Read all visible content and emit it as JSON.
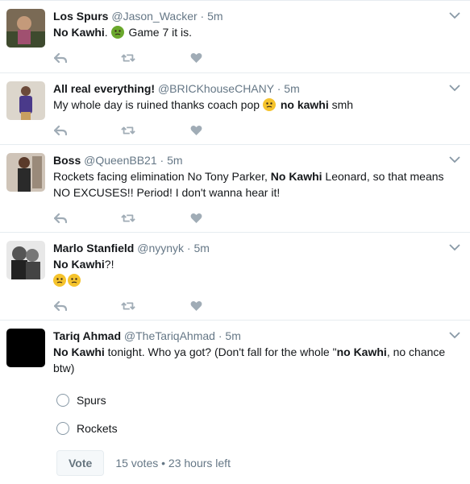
{
  "tweets": [
    {
      "name": "Los Spurs",
      "handle": "@Jason_Wacker",
      "time": "5m",
      "parts": [
        {
          "t": "No Kawhi",
          "b": true
        },
        {
          "t": ". "
        },
        {
          "emoji": "nauseated-face-emoji",
          "color": "#6aa82c"
        },
        {
          "t": " Game 7 it is."
        }
      ]
    },
    {
      "name": "All real everything!",
      "handle": "@BRICKhouseCHANY",
      "time": "5m",
      "parts": [
        {
          "t": "My whole day is ruined thanks coach pop "
        },
        {
          "emoji": "sad-face-emoji",
          "color": "#f5c32c"
        },
        {
          "t": " "
        },
        {
          "t": "no kawhi",
          "b": true
        },
        {
          "t": " smh"
        }
      ]
    },
    {
      "name": "Boss",
      "handle": "@QueenBB21",
      "time": "5m",
      "parts": [
        {
          "t": "Rockets facing elimination No Tony Parker, "
        },
        {
          "t": "No Kawhi",
          "b": true
        },
        {
          "t": " Leonard, so that means NO EXCUSES!! Period! I don't wanna hear it!"
        }
      ]
    },
    {
      "name": "Marlo Stanfield",
      "handle": "@nyynyk",
      "time": "5m",
      "parts": [
        {
          "t": "No Kawhi",
          "b": true
        },
        {
          "t": "?!"
        },
        {
          "br": true
        },
        {
          "emoji": "relieved-face-emoji",
          "color": "#f5c32c"
        },
        {
          "emoji": "relieved-face-emoji",
          "color": "#f5c32c"
        }
      ]
    },
    {
      "name": "Tariq Ahmad",
      "handle": "@TheTariqAhmad",
      "time": "5m",
      "parts": [
        {
          "t": "No Kawhi",
          "b": true
        },
        {
          "t": " tonight. Who ya got? (Don't fall for the whole \""
        },
        {
          "t": "no Kawhi",
          "b": true
        },
        {
          "t": ", no chance btw)"
        }
      ],
      "poll": {
        "options": [
          "Spurs",
          "Rockets"
        ],
        "vote_label": "Vote",
        "meta": "15 votes • 23 hours left"
      }
    }
  ],
  "colors": {
    "icon": "#a0acb6",
    "secondary": "#657786",
    "border": "#e6ecf0"
  }
}
